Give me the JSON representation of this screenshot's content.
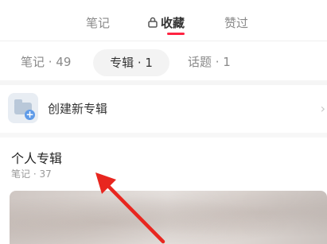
{
  "top_tabs": {
    "notes": "笔记",
    "favorites": "收藏",
    "liked": "赞过",
    "active": "favorites"
  },
  "sub_tabs": {
    "notes": "笔记 · 49",
    "albums": "专辑 · 1",
    "topics": "话题 · 1",
    "active": "albums"
  },
  "create_album": {
    "label": "创建新专辑",
    "icon": "folder-add-icon",
    "arrow_icon": "chevron-right-icon"
  },
  "album": {
    "title": "个人专辑",
    "count": "笔记 · 37"
  },
  "colors": {
    "accent": "#ff2442",
    "annotation_arrow": "#e8261f"
  }
}
